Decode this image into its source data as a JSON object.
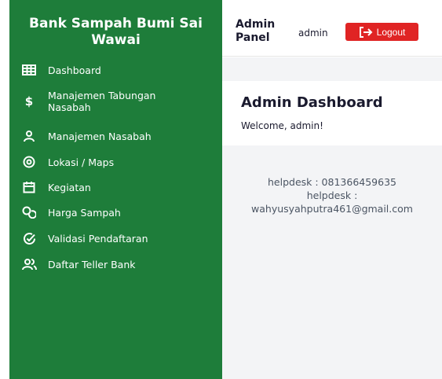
{
  "sidebar": {
    "brand": "Bank Sampah Bumi Sai Wawai",
    "items": [
      {
        "label": "Dashboard",
        "icon": "table-icon"
      },
      {
        "label": "Manajemen Tabungan Nasabah",
        "icon": "dollar-icon"
      },
      {
        "label": "Manajemen Nasabah",
        "icon": "user-icon"
      },
      {
        "label": "Lokasi / Maps",
        "icon": "location-icon"
      },
      {
        "label": "Kegiatan",
        "icon": "calendar-icon"
      },
      {
        "label": "Harga Sampah",
        "icon": "coins-icon"
      },
      {
        "label": "Validasi Pendaftaran",
        "icon": "check-circle-icon"
      },
      {
        "label": "Daftar Teller Bank",
        "icon": "users-icon"
      }
    ]
  },
  "header": {
    "title": "Admin Panel",
    "username": "admin",
    "logout_label": "Logout"
  },
  "main": {
    "heading": "Admin Dashboard",
    "welcome": "Welcome, admin!",
    "helpdesk_phone": "helpdesk : 081366459635",
    "helpdesk_email_label": "helpdesk :",
    "helpdesk_email": "wahyusyahputra461@gmail.com"
  },
  "colors": {
    "sidebar_bg": "#1e7d3a",
    "logout_bg": "#e02424",
    "main_bg": "#f3f4f6"
  }
}
